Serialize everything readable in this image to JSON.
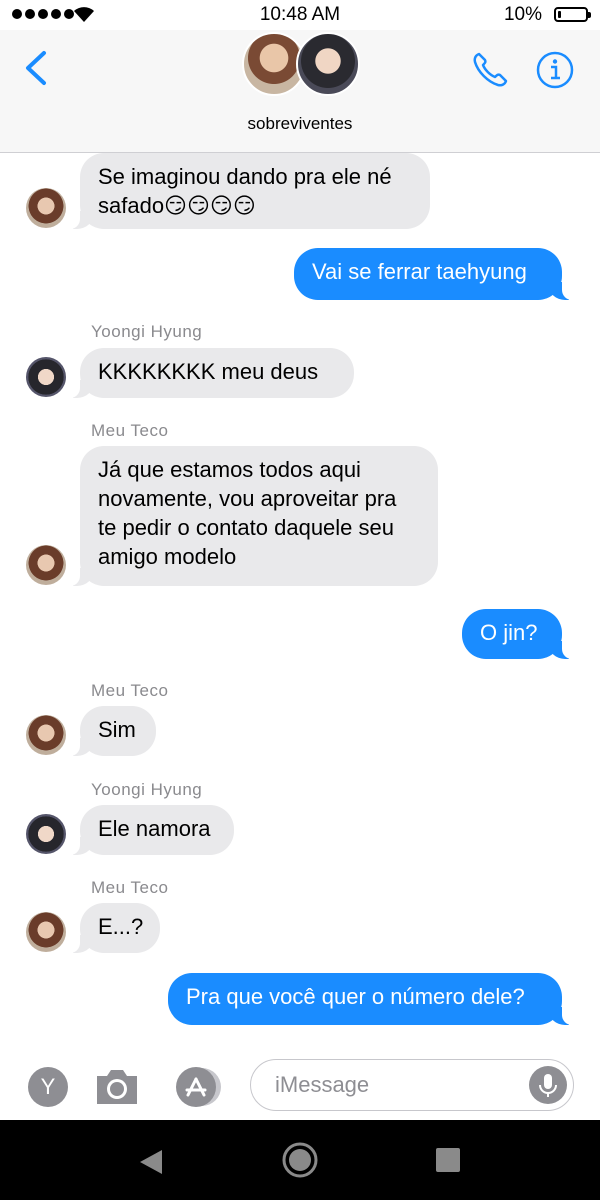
{
  "status_bar": {
    "time": "10:48 AM",
    "battery_percent": "10%",
    "battery_level": 0.1
  },
  "header": {
    "group_name": "sobreviventes",
    "back_icon": "chevron-left-icon",
    "call_icon": "phone-icon",
    "info_icon": "info-icon"
  },
  "messages": [
    {
      "direction": "in",
      "sender": "",
      "text_lines": [
        "Se imaginou dando pra ele né",
        "safado😏😏😏😏"
      ],
      "avatar": "teco"
    },
    {
      "direction": "out",
      "text": "Vai se ferrar taehyung"
    },
    {
      "direction": "in",
      "sender": "Yoongi Hyung",
      "text": "KKKKKKKK meu deus",
      "avatar": "yoongi"
    },
    {
      "direction": "in",
      "sender": "Meu Teco",
      "text_lines": [
        "Já que estamos todos aqui",
        "novamente, vou aproveitar pra",
        "te pedir o contato daquele seu",
        "amigo modelo"
      ],
      "avatar": "teco"
    },
    {
      "direction": "out",
      "text": "O jin?"
    },
    {
      "direction": "in",
      "sender": "Meu Teco",
      "text": "Sim",
      "avatar": "teco"
    },
    {
      "direction": "in",
      "sender": "Yoongi Hyung",
      "text": "Ele namora",
      "avatar": "yoongi"
    },
    {
      "direction": "in",
      "sender": "Meu Teco",
      "text": "E...?",
      "avatar": "teco"
    },
    {
      "direction": "out",
      "text": "Pra que você quer o número dele?"
    }
  ],
  "input_bar": {
    "app_button_label": "Y",
    "placeholder": "iMessage",
    "value": ""
  },
  "colors": {
    "accent": "#1a8cff",
    "incoming_bubble": "#e9e9eb",
    "sender_name": "#8a8a8e"
  }
}
